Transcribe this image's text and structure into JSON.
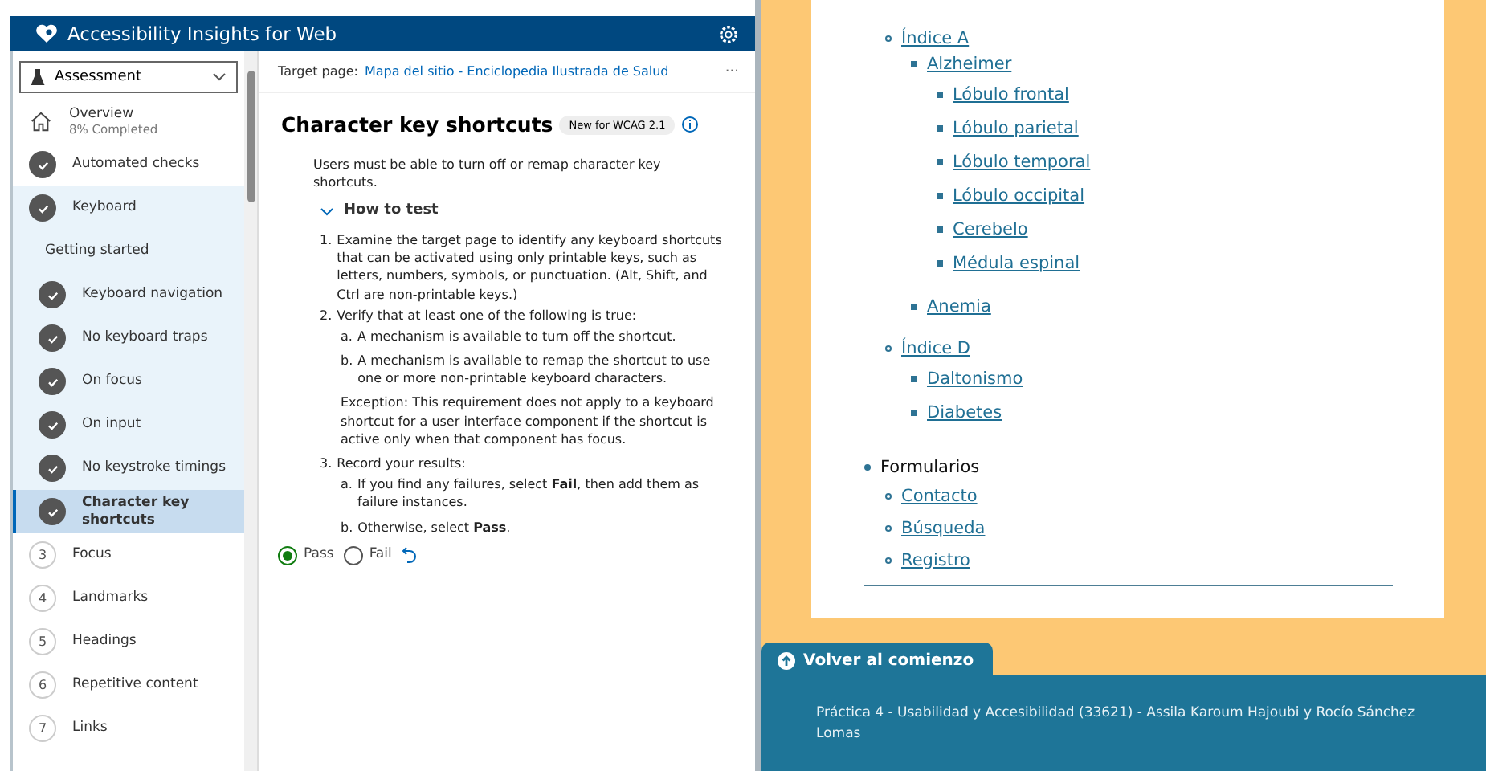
{
  "panel": {
    "title": "Accessibility Insights for Web",
    "mode": "Assessment",
    "nav": [
      {
        "kind": "overview",
        "label": "Overview",
        "subtitle": "8% Completed",
        "selected": false
      },
      {
        "kind": "done",
        "label": "Automated checks",
        "selected": false
      },
      {
        "kind": "done",
        "label": "Keyboard",
        "selected": false,
        "expanded": true,
        "children": [
          {
            "kind": "heading",
            "label": "Getting started",
            "selected": false
          },
          {
            "kind": "done",
            "label": "Keyboard navigation",
            "selected": false
          },
          {
            "kind": "done",
            "label": "No keyboard traps",
            "selected": false
          },
          {
            "kind": "done",
            "label": "On focus",
            "selected": false
          },
          {
            "kind": "done",
            "label": "On input",
            "selected": false
          },
          {
            "kind": "done",
            "label": "No keystroke timings",
            "selected": false
          },
          {
            "kind": "done",
            "label": "Character key shortcuts",
            "selected": true
          }
        ]
      },
      {
        "kind": "number",
        "number": "3",
        "label": "Focus",
        "selected": false
      },
      {
        "kind": "number",
        "number": "4",
        "label": "Landmarks",
        "selected": false
      },
      {
        "kind": "number",
        "number": "5",
        "label": "Headings",
        "selected": false
      },
      {
        "kind": "number",
        "number": "6",
        "label": "Repetitive content",
        "selected": false
      },
      {
        "kind": "number",
        "number": "7",
        "label": "Links",
        "selected": false
      }
    ],
    "target_label": "Target page:",
    "target_link": "Mapa del sitio - Enciclopedia Ilustrada de Salud",
    "more": "···",
    "heading": "Character key shortcuts",
    "badge": "New for WCAG 2.1",
    "intro": "Users must be able to turn off or remap character key shortcuts.",
    "how_to": {
      "label": "How to test",
      "expanded": true
    },
    "steps": [
      {
        "marker": "1.",
        "text": "Examine the target page to identify any keyboard shortcuts that can be activated using only printable keys, such as letters, numbers, symbols, or punctuation. (Alt, Shift, and Ctrl are non-printable keys.)"
      },
      {
        "marker": "2.",
        "text": "Verify that at least one of the following is true:",
        "substeps": [
          {
            "marker": "a.",
            "text": "A mechanism is available to turn off the shortcut."
          },
          {
            "marker": "b.",
            "text": "A mechanism is available to remap the shortcut to use one or more non-printable keyboard characters."
          }
        ],
        "note": "Exception: This requirement does not apply to a keyboard shortcut for a user interface component if the shortcut is active only when that component has focus."
      },
      {
        "marker": "3.",
        "text": "Record your results:",
        "substeps": [
          {
            "marker": "a.",
            "text": "If you find any failures, select **Fail**, then add them as failure instances."
          },
          {
            "marker": "b.",
            "text": "Otherwise, select **Pass**."
          }
        ]
      }
    ],
    "results": [
      {
        "label": "Pass",
        "selected": true
      },
      {
        "label": "Fail",
        "selected": false
      }
    ]
  },
  "site": {
    "tree": [
      {
        "kind": "group",
        "children": [
          {
            "kind": "link",
            "label": "Índice A",
            "children": [
              {
                "kind": "link",
                "label": "Alzheimer",
                "children": [
                  {
                    "kind": "link",
                    "label": "Lóbulo frontal"
                  },
                  {
                    "kind": "link",
                    "label": "Lóbulo parietal"
                  },
                  {
                    "kind": "link",
                    "label": "Lóbulo temporal"
                  },
                  {
                    "kind": "link",
                    "label": "Lóbulo occipital"
                  },
                  {
                    "kind": "link",
                    "label": "Cerebelo"
                  },
                  {
                    "kind": "link",
                    "label": "Médula espinal"
                  }
                ]
              },
              {
                "kind": "link",
                "label": "Anemia"
              }
            ]
          },
          {
            "kind": "link",
            "label": "Índice D",
            "children": [
              {
                "kind": "link",
                "label": "Daltonismo"
              },
              {
                "kind": "link",
                "label": "Diabetes"
              }
            ]
          }
        ]
      },
      {
        "kind": "text",
        "label": "Formularios",
        "children": [
          {
            "kind": "link",
            "label": "Contacto"
          },
          {
            "kind": "link",
            "label": "Búsqueda"
          },
          {
            "kind": "link",
            "label": "Registro"
          }
        ]
      }
    ],
    "back_to_top": "Volver al comienzo",
    "footer": "Práctica 4 - Usabilidad y Accesibilidad (33621) - Assila Karoum Hajoubi y Rocío Sánchez Lomas"
  }
}
